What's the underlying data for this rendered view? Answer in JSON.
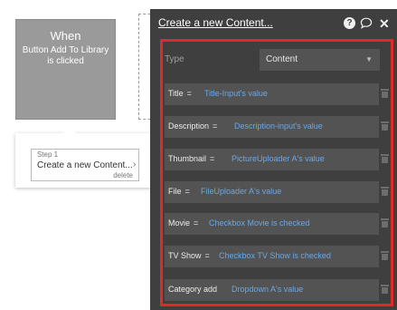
{
  "canvas": {
    "when_block": {
      "title": "When",
      "description": "Button Add To Library is clicked"
    },
    "step": {
      "number": "Step 1",
      "title": "Create a new Content...",
      "delete_label": "delete"
    }
  },
  "editor": {
    "title": "Create a new Content...",
    "icons": {
      "help": "?",
      "comment": "comment-icon",
      "close": "close-icon"
    },
    "type": {
      "label": "Type",
      "value": "Content"
    },
    "fields": [
      {
        "label": "Title",
        "value": "Title-Input's value"
      },
      {
        "label": "Description",
        "value": "Description-input's value"
      },
      {
        "label": "Thumbnail",
        "value": "PictureUploader A's value"
      },
      {
        "label": "File",
        "value": "FileUploader A's value"
      },
      {
        "label": "Movie",
        "value": "Checkbox Movie is checked"
      },
      {
        "label": "TV Show",
        "value": "Checkbox TV Show is checked"
      },
      {
        "label": "Category add",
        "value": "Dropdown A's value"
      }
    ]
  },
  "colors": {
    "panel_bg": "#3f3f3f",
    "field_bg": "#535353",
    "dynamic_value": "#6aa7e6",
    "highlight": "#e02a2a",
    "when_block_bg": "#9a9a9a"
  }
}
